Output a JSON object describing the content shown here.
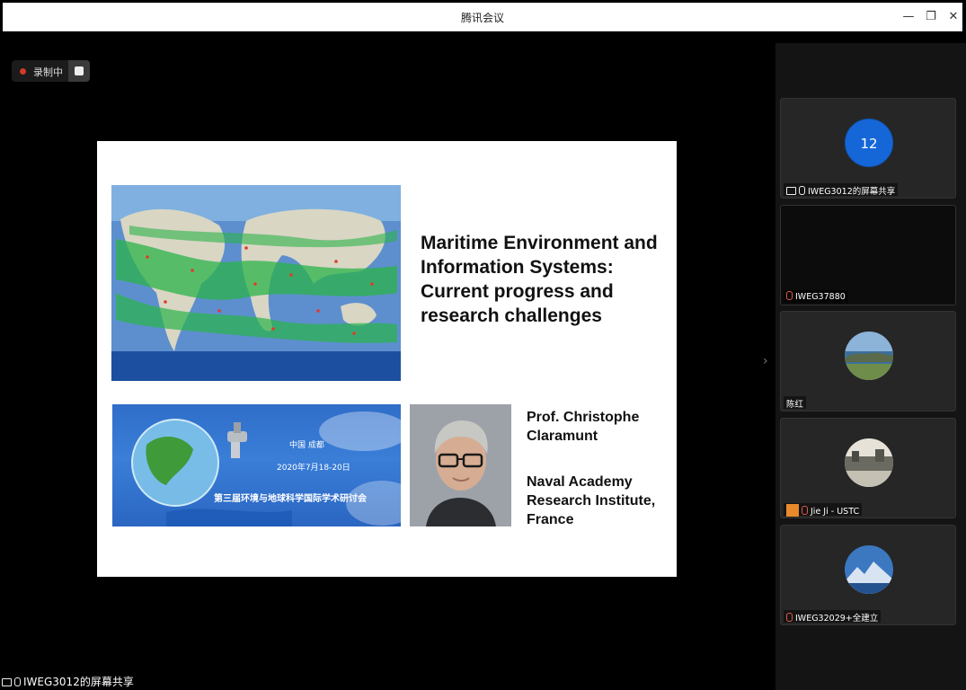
{
  "window": {
    "title": "腾讯会议"
  },
  "recording": {
    "label": "录制中"
  },
  "slide": {
    "title": "Maritime Environment and Information Systems: Current progress and research challenges",
    "banner": {
      "city": "中国 成都",
      "date": "2020年7月18-20日",
      "conference": "第三届环境与地球科学国际学术研讨会"
    },
    "author": "Prof. Christophe Claramunt",
    "institution": "Naval Academy Research Institute, France"
  },
  "participants": [
    {
      "name": "IWEG3012的屏幕共享",
      "avatar_text": "12"
    },
    {
      "name": "IWEG37880"
    },
    {
      "name": "陈红"
    },
    {
      "name": "Jie Ji - USTC"
    },
    {
      "name": "IWEG32029+全建立"
    }
  ],
  "bottom_bar": {
    "sharer_label": "IWEG3012的屏幕共享"
  },
  "colors": {
    "accent": "#1567d8",
    "recording": "#d23a2a",
    "background": "#000000"
  }
}
